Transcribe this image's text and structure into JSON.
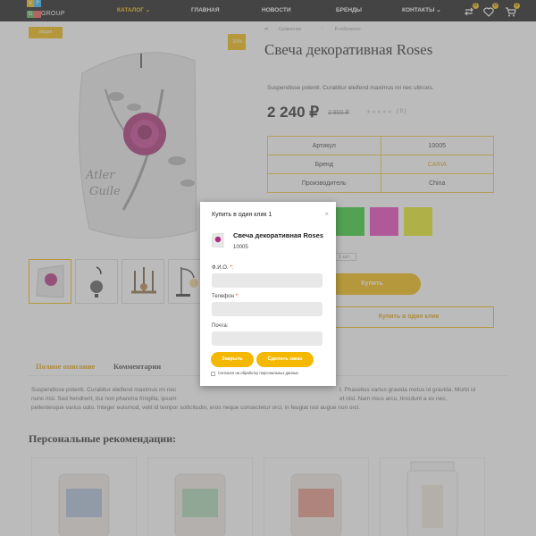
{
  "brand": {
    "logo_letters": [
      "V",
      "P",
      "G"
    ],
    "logo_word": "GROUP",
    "logo_colors": [
      "#f5b800",
      "#29b6f6",
      "#4caf50",
      "#ef5350"
    ]
  },
  "nav": {
    "catalog": "КАТАЛОГ",
    "home": "ГЛАВНАЯ",
    "news": "НОВОСТИ",
    "brands": "БРЕНДЫ",
    "contacts": "КОНТАКТЫ",
    "compare_count": "0",
    "favorites_count": "0",
    "cart_count": "0"
  },
  "product": {
    "promo_badge": "акция",
    "discount_badge": "-30%",
    "compare_link": "Сравнение",
    "favorite_link": "В избранное",
    "title": "Свеча декоративная Roses",
    "short_description": "Suspendisse potenti. Curabitur eleifend maximus mi nec ultrices.",
    "price": "2 240 ₽",
    "old_price": "2 800 ₽",
    "stars": "★★★★★",
    "reviews": "( 0 )",
    "specs": [
      {
        "label": "Артикул",
        "value": "10005"
      },
      {
        "label": "Бренд",
        "value": "CARIA"
      },
      {
        "label": "Производитель",
        "value": "China"
      }
    ],
    "swatch_colors": [
      "#2ecc2e",
      "#e83ab8",
      "#e8e81a"
    ],
    "quantity": "1 шт.",
    "buy_label": "Купить",
    "one_click_label": "Купить в один клик"
  },
  "tabs": {
    "description": "Полное описание",
    "comments": "Комментарии"
  },
  "description": {
    "part1": "Suspendisse potenti. Curabitur eleifend maximus mi nec",
    "part2": "t. Phasellus varius gravida metus id gravida. Morbi id",
    "part3": "nunc nisl. Sed hendrerit, dui non pharetra fringilla, ipsum",
    "part4": "et nisl. Nam risus arcu, tincidunt a ex nec,",
    "line3": "pellentesque varius odio. Integer euismod, velit id tempor sollicitudin, eros neque consectetur orci, in feugiat nisl augue non orci."
  },
  "recommendations": {
    "title": "Персональные рекомендации:",
    "jar_colors": [
      "#a9bfd6",
      "#a9d6b4",
      "#e79080",
      "#ece8d8"
    ]
  },
  "modal": {
    "title": "Купить в один клик 1",
    "close": "×",
    "product_name": "Свеча декоративная Roses",
    "product_code": "10005",
    "name_label": "Ф.И.О.",
    "name_required": "*:",
    "phone_label": "Телефон",
    "phone_required": "*:",
    "email_label": "Почта:",
    "close_button": "Закрыть",
    "submit_button": "Сделать заказ",
    "consent": "Согласен на обработку персональных данных"
  }
}
